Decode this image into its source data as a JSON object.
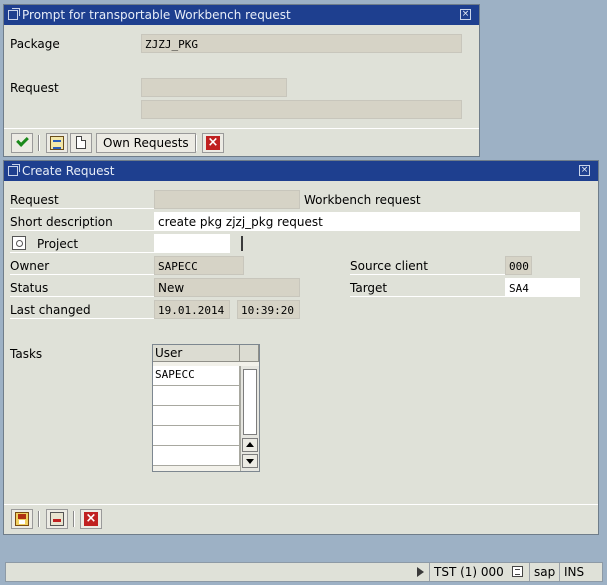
{
  "prompt_dialog": {
    "title": "Prompt for transportable Workbench request",
    "package_label": "Package",
    "package_value": "ZJZJ_PKG",
    "request_label": "Request",
    "request_value": "",
    "request_description_value": "",
    "toolbar": {
      "own_requests_label": "Own Requests"
    }
  },
  "create_dialog": {
    "title": "Create Request",
    "request_label": "Request",
    "request_value": "",
    "request_type": "Workbench request",
    "short_description_label": "Short description",
    "short_description_value": "create pkg zjzj_pkg request",
    "project_label": "Project",
    "project_value": "",
    "owner_label": "Owner",
    "owner_value": "SAPECC",
    "status_label": "Status",
    "status_value": "New",
    "last_changed_label": "Last changed",
    "last_changed_date": "19.01.2014",
    "last_changed_time": "10:39:20",
    "source_client_label": "Source client",
    "source_client_value": "000",
    "target_label": "Target",
    "target_value": "SA4",
    "tasks_label": "Tasks",
    "tasks_table": {
      "column_user": "User",
      "rows": [
        "SAPECC",
        "",
        "",
        "",
        ""
      ]
    }
  },
  "status_bar": {
    "system": "TST (1) 000",
    "server": "sap",
    "mode": "INS"
  },
  "colors": {
    "desktop": "#9db1c5",
    "titlebar": "#1e3f8f",
    "dialog_bg": "#dfe1d8",
    "readonly_field": "#d6d3c6",
    "editable_field": "#ffffff",
    "cancel_red": "#c02020",
    "confirm_green": "#1b8a1b"
  },
  "icons": {
    "confirm": "check-icon",
    "cancel": "cancel-icon",
    "list": "list-icon",
    "new_document": "doc-icon",
    "save": "save-icon",
    "delete_line": "delete-line-icon",
    "project": "project-icon",
    "window": "window-icon",
    "close": "close-icon"
  }
}
